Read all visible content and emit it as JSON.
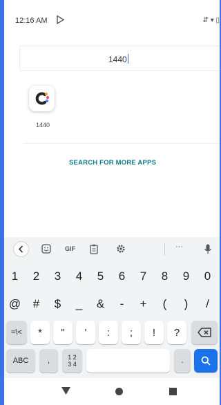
{
  "status_bar": {
    "time": "12:16 AM",
    "right_icons": "⇵ ▾ ▯"
  },
  "search": {
    "query": "1440"
  },
  "results": {
    "app_label": "1440",
    "more_apps": "SEARCH FOR MORE APPS"
  },
  "keyboard": {
    "toolbar": {
      "gif": "GIF",
      "more": "···"
    },
    "number_row": [
      "1",
      "2",
      "3",
      "4",
      "5",
      "6",
      "7",
      "8",
      "9",
      "0"
    ],
    "symbol_row1": [
      "@",
      "#",
      "$",
      "_",
      "&",
      "-",
      "+",
      "(",
      ")",
      "/"
    ],
    "symbol_row2": [
      "=\\<",
      "*",
      "\"",
      "'",
      ":",
      ";",
      "!",
      "?"
    ],
    "bottom_row": {
      "abc": "ABC",
      "comma": ",",
      "numpad_top": "1 2",
      "numpad_bottom": "3 4",
      "period": "."
    }
  },
  "colors": {
    "accent": "#1a73e8",
    "link": "#0f7b86",
    "frame_border": "#3b73e6"
  }
}
